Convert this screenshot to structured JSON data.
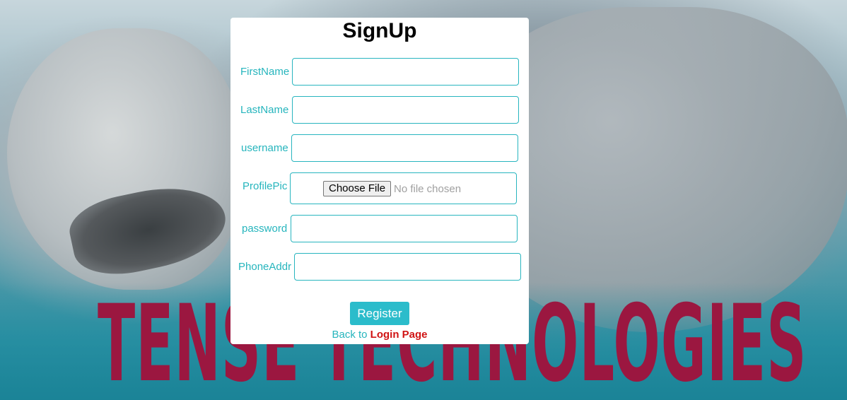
{
  "brand": "TENSE TECHNOLOGIES",
  "form": {
    "title": "SignUp",
    "fields": [
      {
        "label": "FirstName",
        "value": ""
      },
      {
        "label": "LastName",
        "value": ""
      },
      {
        "label": "username",
        "value": ""
      },
      {
        "label": "ProfilePic",
        "button": "Choose File",
        "status": "No file chosen"
      },
      {
        "label": "password",
        "value": ""
      },
      {
        "label": "PhoneAddr",
        "value": ""
      }
    ],
    "register_label": "Register",
    "back_text": "Back to ",
    "login_link": "Login Page"
  },
  "colors": {
    "accent": "#26b5bd",
    "button": "#2bbccb",
    "link": "#d01313",
    "brand": "#9b1740"
  }
}
